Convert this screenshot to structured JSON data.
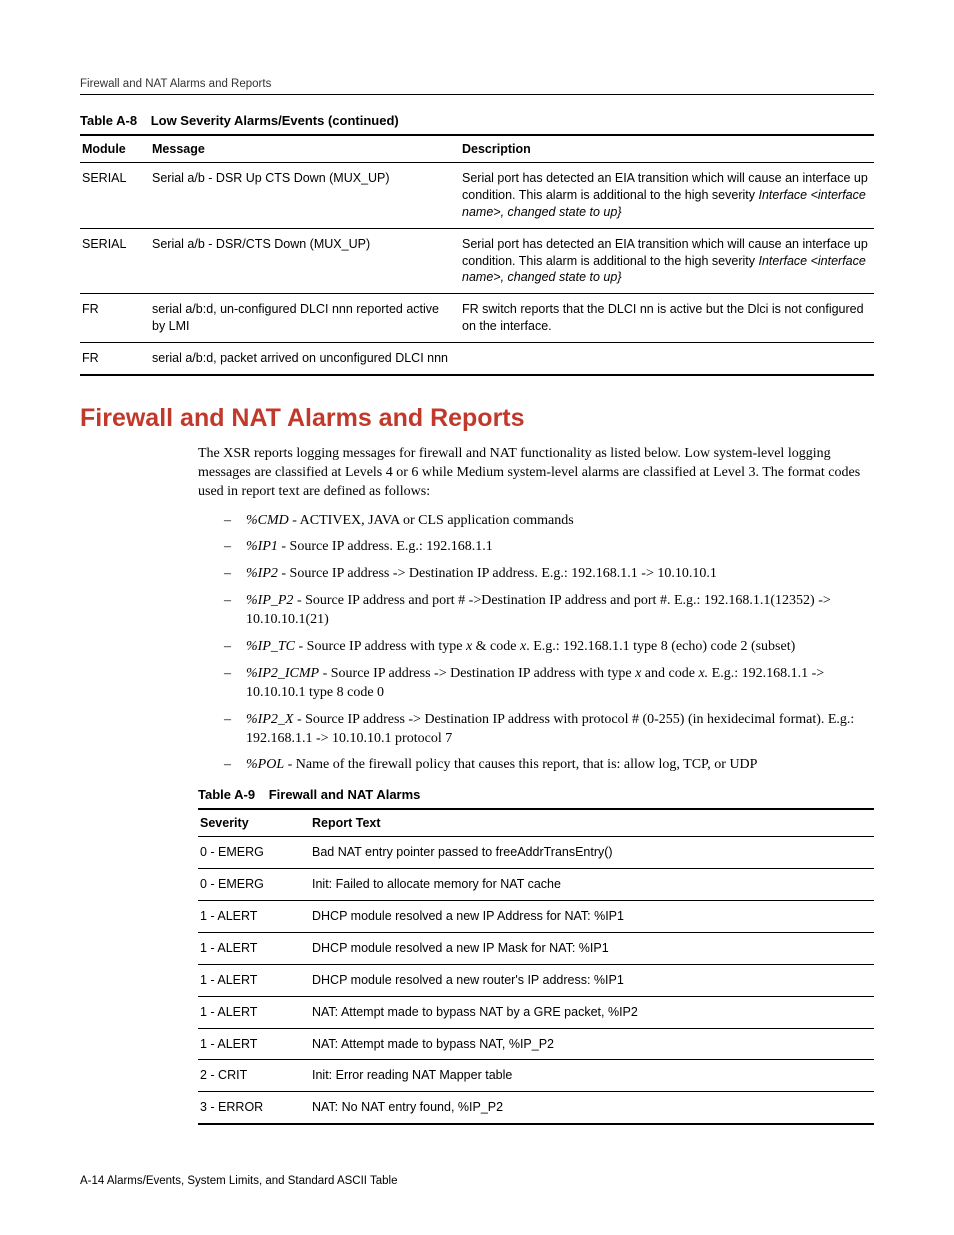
{
  "running_head": "Firewall and NAT Alarms and Reports",
  "table8": {
    "caption_number": "Table A-8",
    "caption_title": "Low Severity Alarms/Events (continued)",
    "headers": {
      "c1": "Module",
      "c2": "Message",
      "c3": "Description"
    },
    "rows": [
      {
        "module": "SERIAL",
        "message": "Serial a/b - DSR Up CTS Down (MUX_UP)",
        "desc_plain": "Serial port has detected an EIA transition which will cause an interface up condition. This alarm is additional to the high severity ",
        "desc_italic": "Interface <interface name>, changed state to up}"
      },
      {
        "module": "SERIAL",
        "message": "Serial a/b - DSR/CTS Down (MUX_UP)",
        "desc_plain": "Serial port has detected an EIA transition which will cause an interface up condition. This alarm is additional to the high severity ",
        "desc_italic": "Interface <interface name>, changed state to up}"
      },
      {
        "module": "FR",
        "message": "serial a/b:d, un-configured DLCI nnn reported active by LMI",
        "desc_plain": "FR switch reports that the DLCI nn is active but the Dlci is not configured on the interface.",
        "desc_italic": ""
      },
      {
        "module": "FR",
        "message": "serial a/b:d, packet arrived on unconfigured DLCI nnn",
        "desc_plain": "",
        "desc_italic": ""
      }
    ]
  },
  "section_title": "Firewall and NAT Alarms and Reports",
  "intro_para": "The XSR reports logging messages for firewall and NAT functionality as listed below. Low system-level logging messages are classified at Levels 4 or 6 while Medium system-level alarms are classified at Level 3. The format codes used in report text are defined as follows:",
  "codes": [
    {
      "term": "%CMD",
      "desc": " - ACTIVEX, JAVA or CLS application commands"
    },
    {
      "term": "%IP1",
      "desc": " - Source IP address. E.g.: 192.168.1.1"
    },
    {
      "term": "%IP2",
      "desc": " - Source IP address -> Destination IP address. E.g.: 192.168.1.1 -> 10.10.10.1"
    },
    {
      "term": "%IP_P2",
      "desc": " - Source IP address and port # ->Destination IP address and port #. E.g.: 192.168.1.1(12352) -> 10.10.10.1(21)"
    },
    {
      "term": "%IP_TC",
      "desc_pre": " - Source IP address with type ",
      "var1": "x",
      "mid1": " & code ",
      "var2": "x",
      "desc_post": ". E.g.: 192.168.1.1 type 8 (echo) code 2 (subset)"
    },
    {
      "term": "%IP2_ICMP",
      "desc_pre": " - Source IP address -> Destination IP address with type ",
      "var1": "x",
      "mid1": " and code ",
      "var2": "x.",
      "desc_post": " E.g.: 192.168.1.1 -> 10.10.10.1 type 8 code 0"
    },
    {
      "term": "%IP2_X",
      "desc": " - Source IP address -> Destination IP address with protocol # (0-255) (in hexidecimal format). E.g.: 192.168.1.1 -> 10.10.10.1 protocol 7"
    },
    {
      "term": "%POL",
      "desc": " - Name of the firewall policy that causes this report, that is: allow log, TCP, or UDP"
    }
  ],
  "table9": {
    "caption_number": "Table A-9",
    "caption_title": "Firewall and NAT Alarms",
    "headers": {
      "c1": "Severity",
      "c2": "Report Text"
    },
    "rows": [
      {
        "sev": "0 - EMERG",
        "text": "Bad NAT entry pointer passed to freeAddrTransEntry()"
      },
      {
        "sev": "0 - EMERG",
        "text": "Init: Failed to allocate memory for NAT cache"
      },
      {
        "sev": "1 - ALERT",
        "text": "DHCP module resolved a new IP Address for NAT: %IP1"
      },
      {
        "sev": "1 - ALERT",
        "text": "DHCP module resolved a new IP Mask for NAT: %IP1"
      },
      {
        "sev": "1 - ALERT",
        "text": "DHCP module resolved a new router's IP address: %IP1"
      },
      {
        "sev": "1 - ALERT",
        "text": "NAT: Attempt made to bypass NAT by a GRE packet, %IP2"
      },
      {
        "sev": "1 - ALERT",
        "text": "NAT: Attempt made to bypass NAT, %IP_P2"
      },
      {
        "sev": "2 - CRIT",
        "text": "Init: Error reading NAT Mapper table"
      },
      {
        "sev": "3 - ERROR",
        "text": "NAT: No NAT entry found, %IP_P2"
      }
    ]
  },
  "footer": "A-14  Alarms/Events, System Limits, and Standard ASCII Table"
}
